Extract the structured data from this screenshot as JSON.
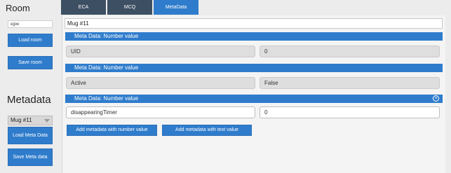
{
  "room": {
    "title": "Room",
    "input_value": "ejpw",
    "load_label": "Load room",
    "save_label": "Save room"
  },
  "metadata_section": {
    "title": "Metadata",
    "selected_object": "Mug #11",
    "load_label": "Load Meta Data",
    "save_label": "Save Meta data"
  },
  "tabs": [
    {
      "label": "ECA",
      "active": false
    },
    {
      "label": "MCQ",
      "active": false
    },
    {
      "label": "MetaData",
      "active": true
    }
  ],
  "main": {
    "object_name": "Mug #11",
    "entries": [
      {
        "header": "Meta Data: Number value",
        "key": "UID",
        "value": "0",
        "editable": false
      },
      {
        "header": "Meta Data: Number value",
        "key": "Active",
        "value": "False",
        "editable": false
      },
      {
        "header": "Meta Data: Number value",
        "key": "disappearingTimer",
        "value": "0",
        "editable": true
      }
    ],
    "add_number_label": "Add metadata with number value",
    "add_text_label": "Add metadata with text value"
  },
  "colors": {
    "accent": "#2f7ccc",
    "tab_inactive": "#3d4f63",
    "background": "#ececec"
  }
}
